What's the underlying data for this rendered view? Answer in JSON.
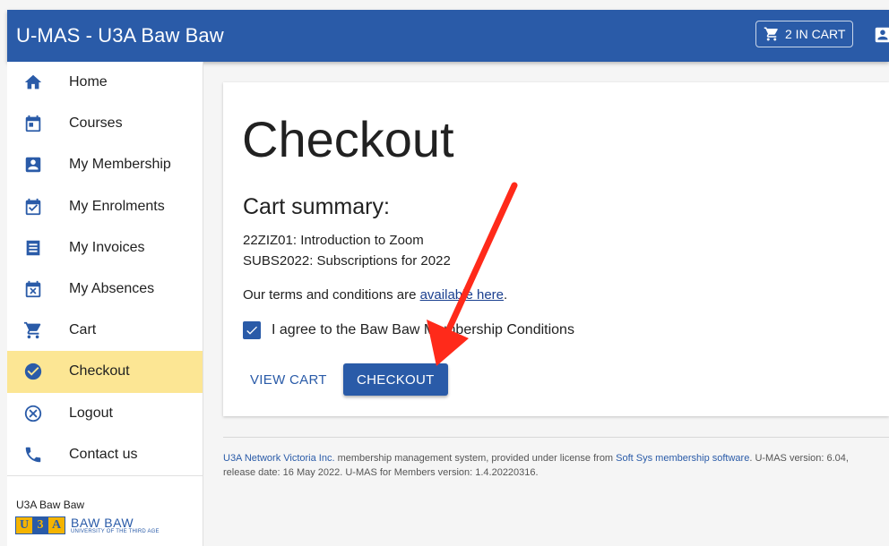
{
  "app": {
    "title": "U-MAS - U3A Baw Baw",
    "cart_label": "2 IN CART"
  },
  "sidebar": {
    "items": [
      {
        "label": "Home",
        "icon": "home-icon"
      },
      {
        "label": "Courses",
        "icon": "calendar-icon"
      },
      {
        "label": "My Membership",
        "icon": "account-box-icon"
      },
      {
        "label": "My Enrolments",
        "icon": "calendar-check-icon"
      },
      {
        "label": "My Invoices",
        "icon": "receipt-icon"
      },
      {
        "label": "My Absences",
        "icon": "calendar-remove-icon"
      },
      {
        "label": "Cart",
        "icon": "cart-icon"
      },
      {
        "label": "Checkout",
        "icon": "check-circle-icon",
        "active": true
      },
      {
        "label": "Logout",
        "icon": "close-circle-icon"
      },
      {
        "label": "Contact us",
        "icon": "phone-icon"
      }
    ],
    "org_name": "U3A Baw Baw",
    "logo": {
      "letters": [
        "U",
        "3",
        "A"
      ],
      "name": "BAW BAW",
      "tagline": "UNIVERSITY OF THE THIRD AGE"
    }
  },
  "main": {
    "title": "Checkout",
    "summary_heading": "Cart summary:",
    "cart_lines": [
      "22ZIZ01: Introduction to Zoom",
      "SUBS2022: Subscriptions for 2022"
    ],
    "terms_prefix": "Our terms and conditions are ",
    "terms_link": "available here",
    "terms_suffix": ".",
    "agree_label": "I agree to the Baw Baw Membership Conditions",
    "agree_checked": true,
    "view_cart_label": "VIEW CART",
    "checkout_label": "CHECKOUT"
  },
  "footer": {
    "org_link": "U3A Network Victoria Inc.",
    "text1": " membership management system, provided under license from ",
    "vendor_link": "Soft Sys membership software",
    "text2": ". U-MAS version: 6.04, release date: 16 May 2022. U-MAS for Members version: 1.4.20220316."
  },
  "colors": {
    "primary": "#2a5ba8",
    "active_item": "#fce694",
    "annotation_arrow": "#ff2a1a"
  }
}
